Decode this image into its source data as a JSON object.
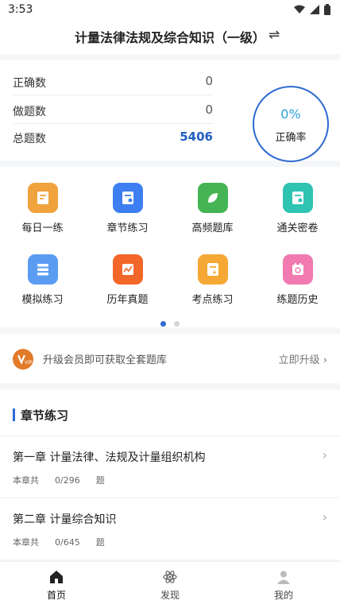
{
  "status_bar": {
    "time": "3:53",
    "icons": [
      "wifi-icon",
      "signal-icon",
      "battery-icon"
    ]
  },
  "header": {
    "title": "计量法律法规及综合知识（一级）",
    "switch_icon": "⇌"
  },
  "stats": {
    "rows": [
      {
        "label": "正确数",
        "value": "0"
      },
      {
        "label": "做题数",
        "value": "0"
      },
      {
        "label": "总题数",
        "value": "5406"
      }
    ],
    "accuracy": {
      "value": "0%",
      "label": "正确率"
    }
  },
  "grid": {
    "items": [
      {
        "label": "每日一练",
        "icon": "daily-practice-icon",
        "color": "#f0a23c"
      },
      {
        "label": "章节练习",
        "icon": "chapter-practice-icon",
        "color": "#3d7ff0"
      },
      {
        "label": "高频题库",
        "icon": "leaf-icon",
        "color": "#44b454"
      },
      {
        "label": "通关密卷",
        "icon": "secret-paper-icon",
        "color": "#2fc3b2"
      },
      {
        "label": "模拟练习",
        "icon": "mock-practice-icon",
        "color": "#5b9cf3"
      },
      {
        "label": "历年真题",
        "icon": "past-exams-icon",
        "color": "#f2662a"
      },
      {
        "label": "考点练习",
        "icon": "key-points-icon",
        "color": "#f5a834"
      },
      {
        "label": "练题历史",
        "icon": "history-icon",
        "color": "#f17ab0"
      }
    ],
    "page_dots": 2,
    "active_dot": 0
  },
  "upgrade": {
    "text": "升级会员即可获取全套题库",
    "link": "立即升级",
    "badge": "VIP"
  },
  "chapters": {
    "title": "章节练习",
    "items": [
      {
        "name": "第一章 计量法律、法规及计量组织机构",
        "prefix": "本章共",
        "progress": "0/296",
        "unit": "题"
      },
      {
        "name": "第二章 计量综合知识",
        "prefix": "本章共",
        "progress": "0/645",
        "unit": "题"
      }
    ]
  },
  "tabbar": {
    "tabs": [
      {
        "label": "首页",
        "icon": "home-icon",
        "active": true
      },
      {
        "label": "发现",
        "icon": "discover-icon",
        "active": false
      },
      {
        "label": "我的",
        "icon": "profile-icon",
        "active": false
      }
    ]
  },
  "colors": {
    "accent": "#2d6ad1",
    "accuracy_text": "#2ba1d6",
    "background": "#f5f6f8"
  }
}
